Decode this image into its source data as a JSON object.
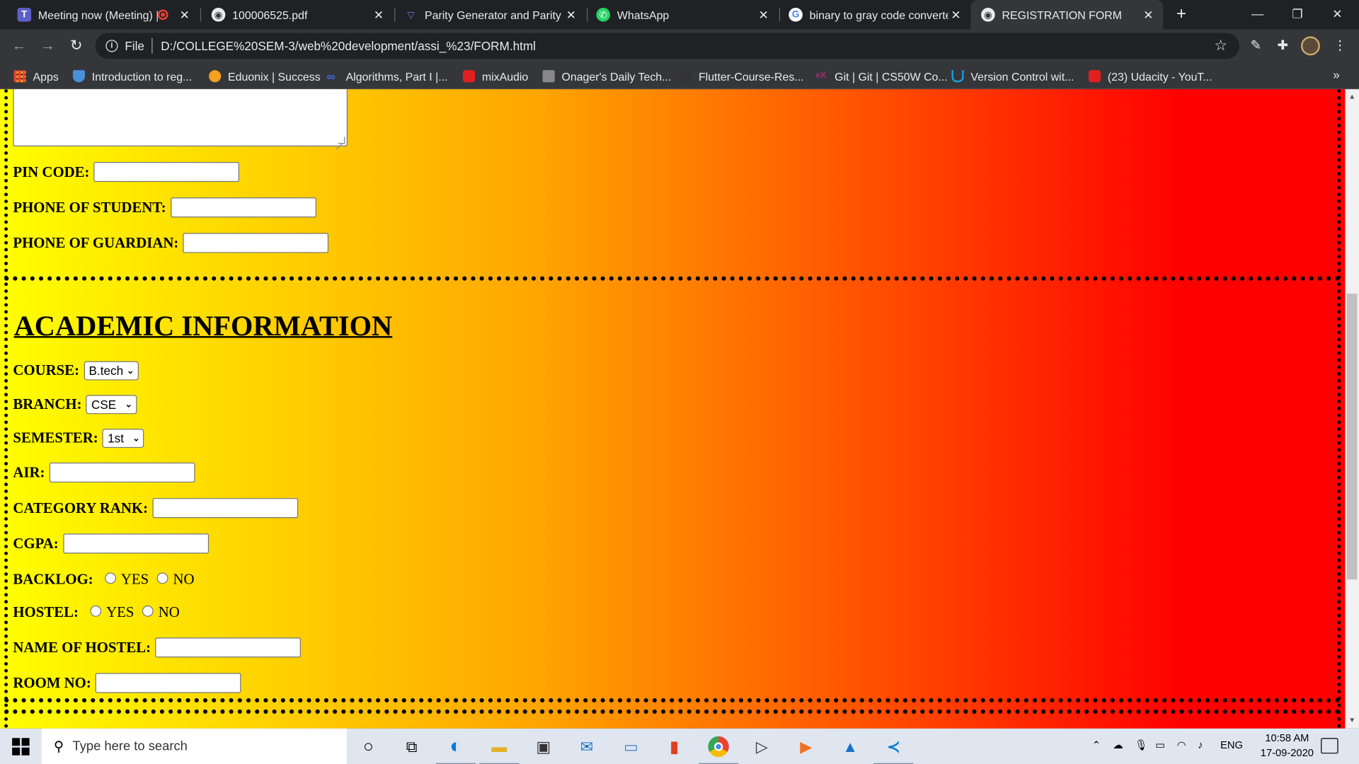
{
  "browser": {
    "tabs": [
      {
        "title": "Meeting now (Meeting) |",
        "icon": "teams-icon",
        "active": false
      },
      {
        "title": "100006525.pdf",
        "icon": "globe-icon",
        "active": false
      },
      {
        "title": "Parity Generator and Parity C",
        "icon": "triangle-icon",
        "active": false
      },
      {
        "title": "WhatsApp",
        "icon": "whatsapp-icon",
        "active": false
      },
      {
        "title": "binary to gray code converte",
        "icon": "google-icon",
        "active": false
      },
      {
        "title": "REGISTRATION FORM",
        "icon": "globe-icon",
        "active": true
      }
    ],
    "omnibox": {
      "scheme": "File",
      "url": "D:/COLLEGE%20SEM-3/web%20development/assi_%23/FORM.html"
    },
    "bookmarks": [
      {
        "label": "Apps",
        "color": "#ea4335"
      },
      {
        "label": "Introduction to reg...",
        "color": "#4a90d9"
      },
      {
        "label": "Eduonix | Success",
        "color": "#f4a020"
      },
      {
        "label": "Algorithms, Part I |...",
        "color": "#3b6cd8"
      },
      {
        "label": "mixAudio",
        "color": "#e02020"
      },
      {
        "label": "Onager's Daily Tech...",
        "color": "#888888"
      },
      {
        "label": "Flutter-Course-Res...",
        "color": "#333333"
      },
      {
        "label": "Git | Git | CS50W Co...",
        "color": "#a03070"
      },
      {
        "label": "Version Control wit...",
        "color": "#1aa0e0"
      },
      {
        "label": "(23) Udacity - YouT...",
        "color": "#e02020"
      }
    ],
    "more_bookmarks": "»"
  },
  "page": {
    "contact": {
      "pin_code_label": "PIN CODE:",
      "pin_code_value": "",
      "phone_student_label": "PHONE OF STUDENT:",
      "phone_student_value": "",
      "phone_guardian_label": "PHONE OF GUARDIAN:",
      "phone_guardian_value": ""
    },
    "academic": {
      "heading": "ACADEMIC INFORMATION",
      "course_label": "COURSE:",
      "course_selected": "B.tech",
      "branch_label": "BRANCH:",
      "branch_selected": "CSE",
      "semester_label": "SEMESTER:",
      "semester_selected": "1st",
      "air_label": "AIR:",
      "category_rank_label": "CATEGORY RANK:",
      "cgpa_label": "CGPA:",
      "backlog_label": "BACKLOG:",
      "hostel_label": "HOSTEL:",
      "yes_label": "YES",
      "no_label": "NO",
      "hostel_name_label": "NAME OF HOSTEL:",
      "room_no_label": "ROOM NO:"
    }
  },
  "taskbar": {
    "search_placeholder": "Type here to search",
    "language": "ENG",
    "time": "10:58 AM",
    "date": "17-09-2020"
  }
}
